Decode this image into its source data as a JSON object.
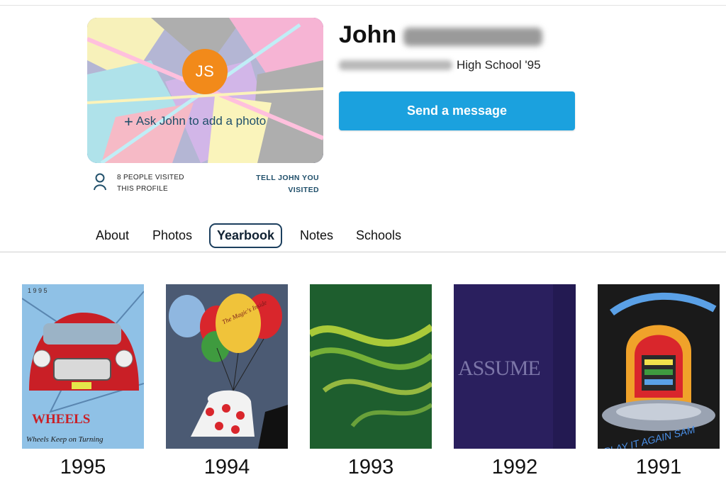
{
  "profile": {
    "initials": "JS",
    "first_name": "John",
    "school_suffix": "High School '95",
    "ask_photo_label": "Ask John to add a photo",
    "visits_line1": "8 PEOPLE VISITED",
    "visits_line2": "THIS PROFILE",
    "tell_line1": "TELL JOHN YOU",
    "tell_line2": "VISITED",
    "send_message_label": "Send a message",
    "colors": {
      "accent": "#1ba1de",
      "avatar": "#f28a1a",
      "link": "#21506b"
    }
  },
  "tabs": [
    {
      "label": "About"
    },
    {
      "label": "Photos"
    },
    {
      "label": "Yearbook",
      "active": true
    },
    {
      "label": "Notes"
    },
    {
      "label": "Schools"
    }
  ],
  "yearbooks": [
    {
      "year": "1995",
      "cover_text_1": "WHEELS",
      "cover_text_2": "Wheels Keep on Turning",
      "cover_text_3": "1 9 9 5"
    },
    {
      "year": "1994",
      "cover_text_1": "The Magic's Inside"
    },
    {
      "year": "1993"
    },
    {
      "year": "1992",
      "cover_text_1": "ASSUME"
    },
    {
      "year": "1991",
      "cover_text_1": "PLAY IT AGAIN SAM"
    }
  ]
}
